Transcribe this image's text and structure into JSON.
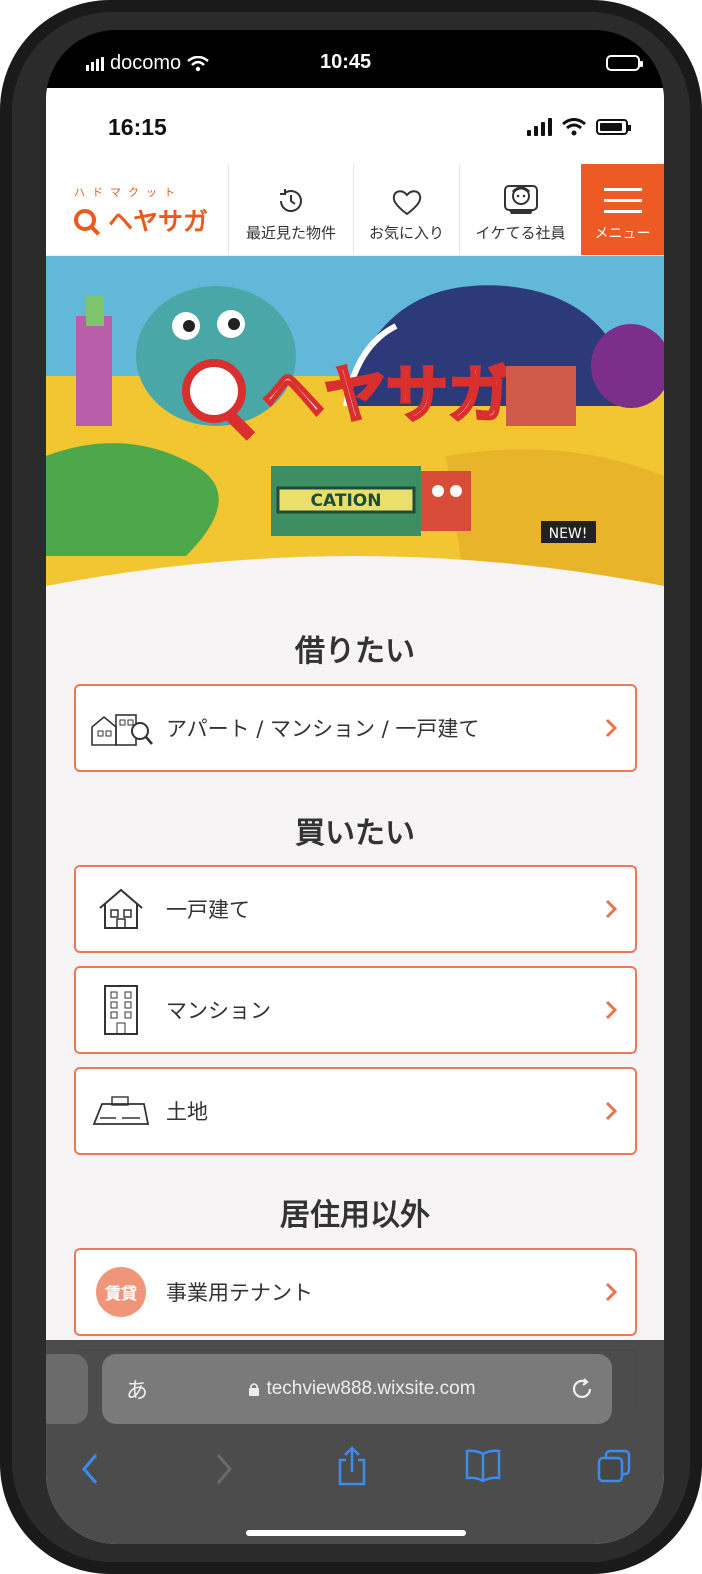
{
  "device_status": {
    "carrier": "docomo",
    "time": "10:45"
  },
  "screenshot_status": {
    "time": "16:15"
  },
  "header": {
    "logo_small": "ハドマクット",
    "logo_main": "ヘヤサガ",
    "nav": [
      {
        "label": "最近見た物件",
        "icon": "clock-history-icon"
      },
      {
        "label": "お気に入り",
        "icon": "heart-icon"
      },
      {
        "label": "イケてる社員",
        "icon": "staff-face-icon"
      },
      {
        "label": "メニュー",
        "icon": "hamburger-icon"
      }
    ]
  },
  "hero": {
    "title": "ヘヤサガ",
    "station_sign": "CATION",
    "badge": "NEW!"
  },
  "sections": {
    "rent": {
      "title": "借りたい",
      "items": [
        {
          "label": "アパート / マンション / 一戸建て",
          "icon": "houses-search-icon"
        }
      ]
    },
    "buy": {
      "title": "買いたい",
      "items": [
        {
          "label": "一戸建て",
          "icon": "house-icon"
        },
        {
          "label": "マンション",
          "icon": "apartment-building-icon"
        },
        {
          "label": "土地",
          "icon": "land-plot-icon"
        }
      ]
    },
    "other": {
      "title": "居住用以外",
      "items": [
        {
          "label": "事業用テナント",
          "badge": "賃貸"
        }
      ]
    }
  },
  "browser": {
    "aa_label": "あ",
    "url": "techview888.wixsite.com"
  },
  "colors": {
    "accent": "#ee5a24",
    "border": "#ea7a57",
    "badge": "#f0957a",
    "hero_yellow": "#f2c631",
    "hero_blue": "#2c3a7a"
  }
}
